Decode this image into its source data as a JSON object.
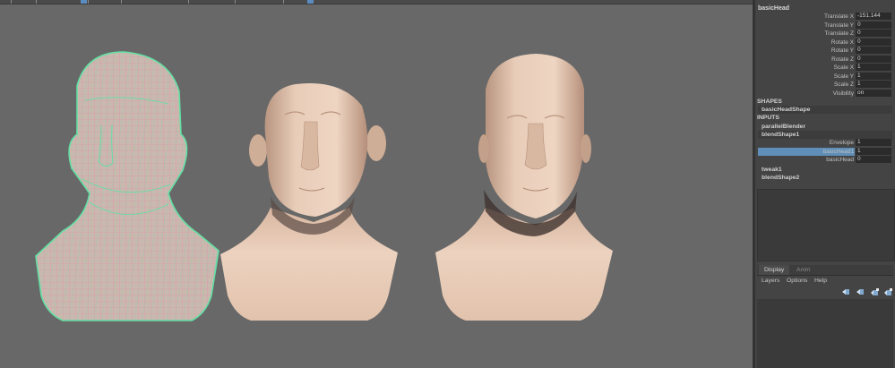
{
  "colors": {
    "viewport_bg": "#686868",
    "panel_bg": "#444444",
    "skin": "#e2c4ae",
    "wire_green": "#62e0a4",
    "wire_pink": "#e68cae",
    "selection": "#5f8fb8"
  },
  "viewport": {
    "models": [
      {
        "name": "wireframe-head",
        "style": "wireframe-on-shaded"
      },
      {
        "name": "blended-head",
        "style": "smooth-shaded"
      },
      {
        "name": "target-head",
        "style": "smooth-shaded"
      }
    ]
  },
  "channel_box": {
    "object_name": "basicHead",
    "attributes": [
      {
        "label": "Translate X",
        "value": "-151.144"
      },
      {
        "label": "Translate Y",
        "value": "0"
      },
      {
        "label": "Translate Z",
        "value": "0"
      },
      {
        "label": "Rotate X",
        "value": "0"
      },
      {
        "label": "Rotate Y",
        "value": "0"
      },
      {
        "label": "Rotate Z",
        "value": "0"
      },
      {
        "label": "Scale X",
        "value": "1"
      },
      {
        "label": "Scale Y",
        "value": "1"
      },
      {
        "label": "Scale Z",
        "value": "1"
      },
      {
        "label": "Visibility",
        "value": "on"
      }
    ],
    "shapes_header": "SHAPES",
    "shape_name": "basicHeadShape",
    "inputs_header": "INPUTS",
    "inputs": [
      {
        "name": "parallelBlender"
      },
      {
        "name": "blendShape1"
      }
    ],
    "blend_attributes": [
      {
        "label": "Envelope",
        "value": "1"
      },
      {
        "label": "basicHead1",
        "value": "1",
        "selected": true
      },
      {
        "label": "basicHead",
        "value": "0"
      }
    ],
    "more_inputs": [
      {
        "name": "tweak1"
      },
      {
        "name": "blendShape2"
      }
    ]
  },
  "layer_editor": {
    "tabs": [
      "Display",
      "Anim"
    ],
    "active_tab": "Display",
    "menu": [
      "Layers",
      "Options",
      "Help"
    ],
    "icons": [
      "layer-move-up-icon",
      "layer-move-down-icon",
      "new-layer-icon",
      "new-layer-selected-icon"
    ]
  }
}
